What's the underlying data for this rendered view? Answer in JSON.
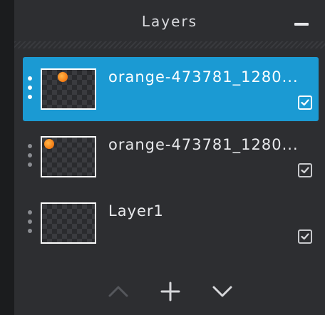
{
  "panel": {
    "title": "Layers",
    "minimize_icon": "minimize-icon"
  },
  "layers": [
    {
      "name": "orange-473781_1280...",
      "selected": true,
      "visible": true,
      "thumbnail": "orange image"
    },
    {
      "name": "orange-473781_1280...",
      "selected": false,
      "visible": true,
      "thumbnail": "orange image"
    },
    {
      "name": "Layer1",
      "selected": false,
      "visible": true,
      "thumbnail": "empty"
    }
  ],
  "footer": {
    "move_up_icon": "chevron-up-icon",
    "add_icon": "plus-icon",
    "move_down_icon": "chevron-down-icon"
  },
  "colors": {
    "accent": "#1b9ad3",
    "panel_bg": "#2d2e31",
    "text": "#e8e9ec",
    "orange": "#f47a12"
  }
}
